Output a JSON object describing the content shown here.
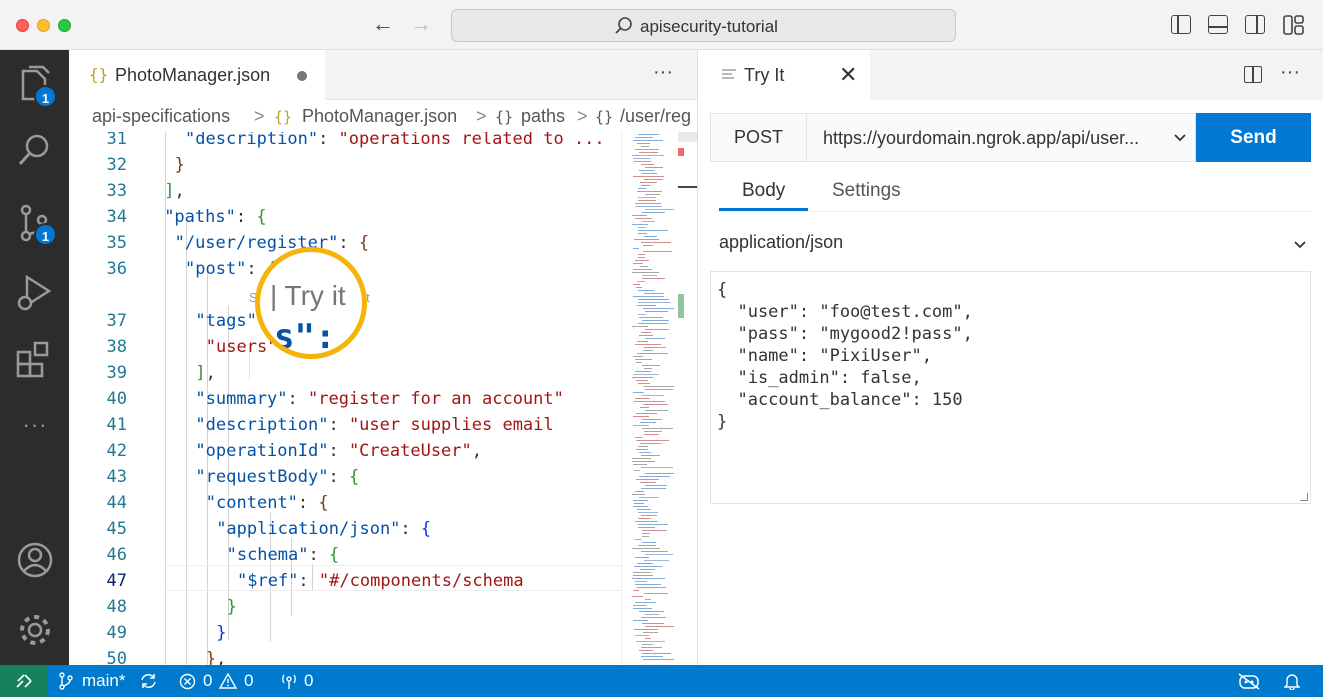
{
  "window": {
    "title": "apisecurity-tutorial"
  },
  "activity_bar": {
    "explorer_badge": "1",
    "scm_badge": "1",
    "more": "···"
  },
  "editor": {
    "tab": {
      "icon": "{}",
      "label": "PhotoManager.json",
      "more": "···"
    },
    "breadcrumb": [
      "api-specifications",
      ">",
      "{}",
      "PhotoManager.json",
      ">",
      "{}",
      "paths",
      ">",
      "{}",
      "/user/reg"
    ],
    "code_lens": "S",
    "code_lens_tail": "dit",
    "callout_text": "| Try it",
    "current_line": "47",
    "lines": [
      {
        "n": "31",
        "parts": [
          [
            "k",
            "\"description\""
          ],
          [
            "p",
            ": "
          ],
          [
            "s",
            "\"operations related to ..."
          ]
        ]
      },
      {
        "n": "32",
        "parts": [
          [
            "b3",
            "}"
          ]
        ]
      },
      {
        "n": "33",
        "parts": [
          [
            "b2",
            "]"
          ],
          [
            "p",
            ","
          ]
        ]
      },
      {
        "n": "34",
        "parts": [
          [
            "k",
            "\"paths\""
          ],
          [
            "p",
            ": "
          ],
          [
            "b2",
            "{"
          ]
        ]
      },
      {
        "n": "35",
        "parts": [
          [
            "k",
            "\"/user/register\""
          ],
          [
            "p",
            ": "
          ],
          [
            "b3",
            "{"
          ]
        ]
      },
      {
        "n": "36",
        "parts": [
          [
            "k",
            "\"post\""
          ],
          [
            "p",
            ": "
          ],
          [
            "b1",
            "{"
          ]
        ]
      },
      {
        "n": "37",
        "parts": [
          [
            "k",
            "\"tags\""
          ],
          [
            "p",
            ": "
          ],
          [
            "b2",
            "["
          ]
        ]
      },
      {
        "n": "38",
        "parts": [
          [
            "s",
            "\"users\""
          ]
        ]
      },
      {
        "n": "39",
        "parts": [
          [
            "b2",
            "]"
          ],
          [
            "p",
            ","
          ]
        ]
      },
      {
        "n": "40",
        "parts": [
          [
            "k",
            "\"summary\""
          ],
          [
            "p",
            ": "
          ],
          [
            "s",
            "\"register for an account\""
          ]
        ]
      },
      {
        "n": "41",
        "parts": [
          [
            "k",
            "\"description\""
          ],
          [
            "p",
            ": "
          ],
          [
            "s",
            "\"user supplies email"
          ]
        ]
      },
      {
        "n": "42",
        "parts": [
          [
            "k",
            "\"operationId\""
          ],
          [
            "p",
            ": "
          ],
          [
            "s",
            "\"CreateUser\""
          ],
          [
            "p",
            ","
          ]
        ]
      },
      {
        "n": "43",
        "parts": [
          [
            "k",
            "\"requestBody\""
          ],
          [
            "p",
            ": "
          ],
          [
            "b2",
            "{"
          ]
        ]
      },
      {
        "n": "44",
        "parts": [
          [
            "k",
            "\"content\""
          ],
          [
            "p",
            ": "
          ],
          [
            "b3",
            "{"
          ]
        ]
      },
      {
        "n": "45",
        "parts": [
          [
            "k",
            "\"application/json\""
          ],
          [
            "p",
            ": "
          ],
          [
            "b1",
            "{"
          ]
        ]
      },
      {
        "n": "46",
        "parts": [
          [
            "k",
            "\"schema\""
          ],
          [
            "p",
            ": "
          ],
          [
            "b2",
            "{"
          ]
        ]
      },
      {
        "n": "47",
        "parts": [
          [
            "k",
            "\"$ref\""
          ],
          [
            "p",
            ": "
          ],
          [
            "s",
            "\"#/components/schema"
          ]
        ]
      },
      {
        "n": "48",
        "parts": [
          [
            "b2",
            "}"
          ]
        ]
      },
      {
        "n": "49",
        "parts": [
          [
            "b1",
            "}"
          ]
        ]
      },
      {
        "n": "50",
        "parts": [
          [
            "b3",
            "}"
          ],
          [
            "p",
            ","
          ]
        ]
      }
    ]
  },
  "try_it": {
    "tab_label": "Try It",
    "more": "···",
    "method": "POST",
    "url": "https://yourdomain.ngrok.app/api/user...",
    "send_label": "Send",
    "tabs": [
      "Body",
      "Settings"
    ],
    "content_type": "application/json",
    "body_lines": [
      "{",
      "  \"user\": \"foo@test.com\",",
      "  \"pass\": \"mygood2!pass\",",
      "  \"name\": \"PixiUser\",",
      "  \"is_admin\": false,",
      "  \"account_balance\": 150",
      "}"
    ]
  },
  "status_bar": {
    "branch": "main*",
    "errors": "0",
    "warnings": "0",
    "ports": "0"
  },
  "colors": {
    "accent": "#0078d4",
    "statusbar": "#007acc",
    "remote": "#16825d",
    "callout": "#f5b40a"
  }
}
